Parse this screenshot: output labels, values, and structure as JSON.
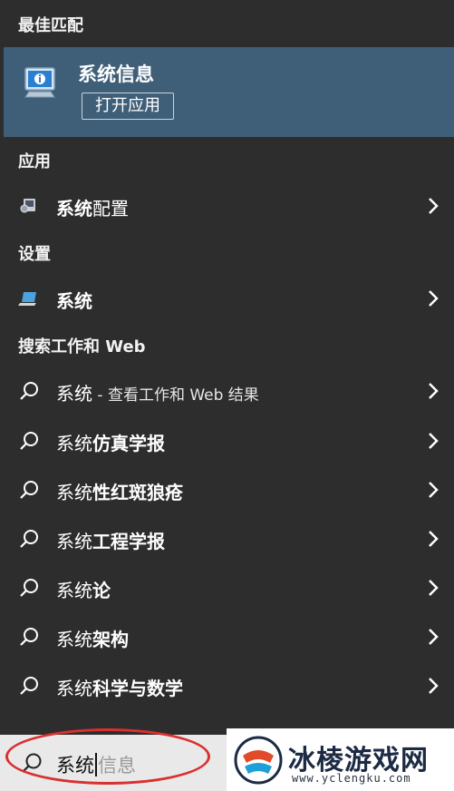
{
  "sections": {
    "best_match": "最佳匹配",
    "apps": "应用",
    "settings": "设置",
    "search_web": "搜索工作和 Web"
  },
  "best_match": {
    "name": "系统信息",
    "open_label": "打开应用"
  },
  "apps": [
    {
      "bold": "系统",
      "rest": "配置",
      "icon": "system-config-icon"
    }
  ],
  "settings": [
    {
      "bold": "系统",
      "rest": "",
      "icon": "laptop-icon"
    }
  ],
  "web_results": [
    {
      "prefix": "系统",
      "bold": "",
      "suffix": " - 查看工作和 Web 结果"
    },
    {
      "prefix": "系统",
      "bold": "仿真学报",
      "suffix": ""
    },
    {
      "prefix": "系统",
      "bold": "性红斑狼疮",
      "suffix": ""
    },
    {
      "prefix": "系统",
      "bold": "工程学报",
      "suffix": ""
    },
    {
      "prefix": "系统",
      "bold": "论",
      "suffix": ""
    },
    {
      "prefix": "系统",
      "bold": "架构",
      "suffix": ""
    },
    {
      "prefix": "系统",
      "bold": "科学与数学",
      "suffix": ""
    }
  ],
  "search": {
    "typed": "系统",
    "hint": "信息"
  },
  "watermark": {
    "text": "冰棱游戏网",
    "url": "www.yclengku.com"
  },
  "colors": {
    "background": "#2d2d2d",
    "highlight": "#3f5f79",
    "annotation": "#d9302f"
  }
}
